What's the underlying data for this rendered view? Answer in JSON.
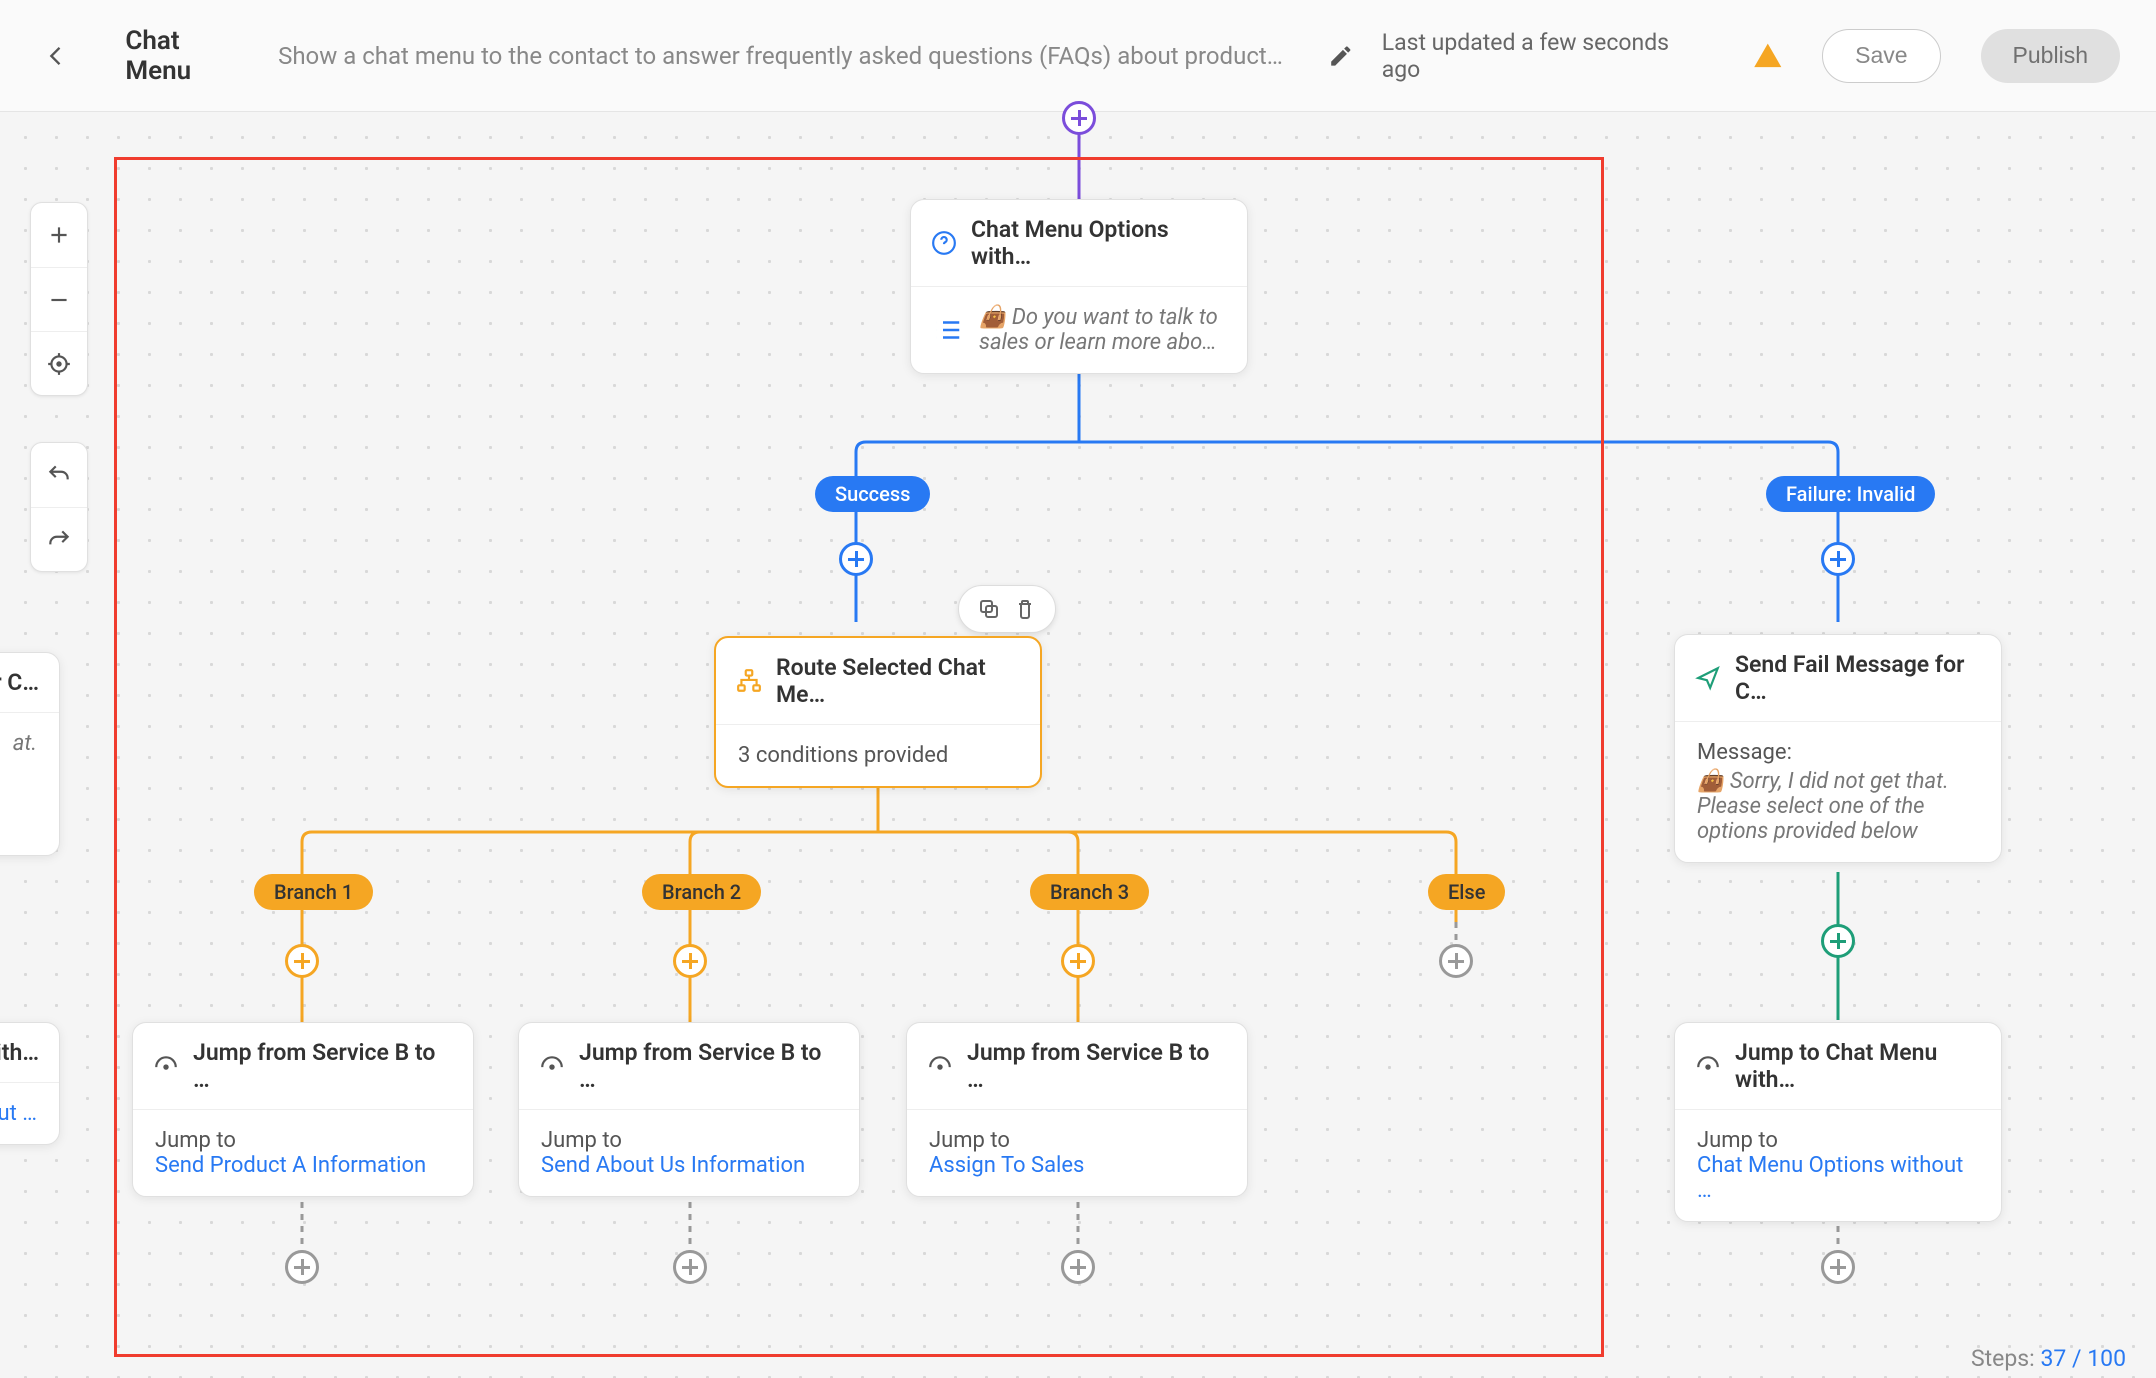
{
  "header": {
    "title": "Chat Menu",
    "description": "Show a chat menu to the contact to answer frequently asked questions (FAQs) about products, servic…",
    "updated": "Last updated a few seconds ago",
    "save_label": "Save",
    "publish_label": "Publish"
  },
  "steps": {
    "label": "Steps:",
    "current": "37",
    "sep": " / ",
    "total": "100"
  },
  "nodes": {
    "top": {
      "title": "Chat Menu Options with…",
      "body_text": "Do you want to talk to sales or learn more abo…",
      "emoji_label": "👜"
    },
    "route": {
      "title": "Route Selected Chat Me…",
      "subtitle": "3 conditions provided"
    },
    "fail": {
      "title": "Send Fail Message for C…",
      "msg_label": "Message:",
      "emoji_label": "👜",
      "msg_text": "Sorry, I did not get that. Please select one of the options provided below"
    },
    "jumpA": {
      "title": "Jump from Service B to …",
      "label": "Jump to",
      "target": "Send Product A Information"
    },
    "jumpB": {
      "title": "Jump from Service B to …",
      "label": "Jump to",
      "target": "Send About Us Information"
    },
    "jumpC": {
      "title": "Jump from Service B to …",
      "label": "Jump to",
      "target": "Assign To Sales"
    },
    "jumpChat": {
      "title": "Jump to Chat Menu with…",
      "label": "Jump to",
      "target": "Chat Menu Options without …"
    },
    "leftCut1": {
      "title_suffix": "or C…",
      "body": "at."
    },
    "leftCut2": {
      "title_suffix": "with…",
      "target_suffix": "hout …"
    }
  },
  "badges": {
    "success": "Success",
    "failure": "Failure: Invalid",
    "b1": "Branch 1",
    "b2": "Branch 2",
    "b3": "Branch 3",
    "else": "Else"
  }
}
